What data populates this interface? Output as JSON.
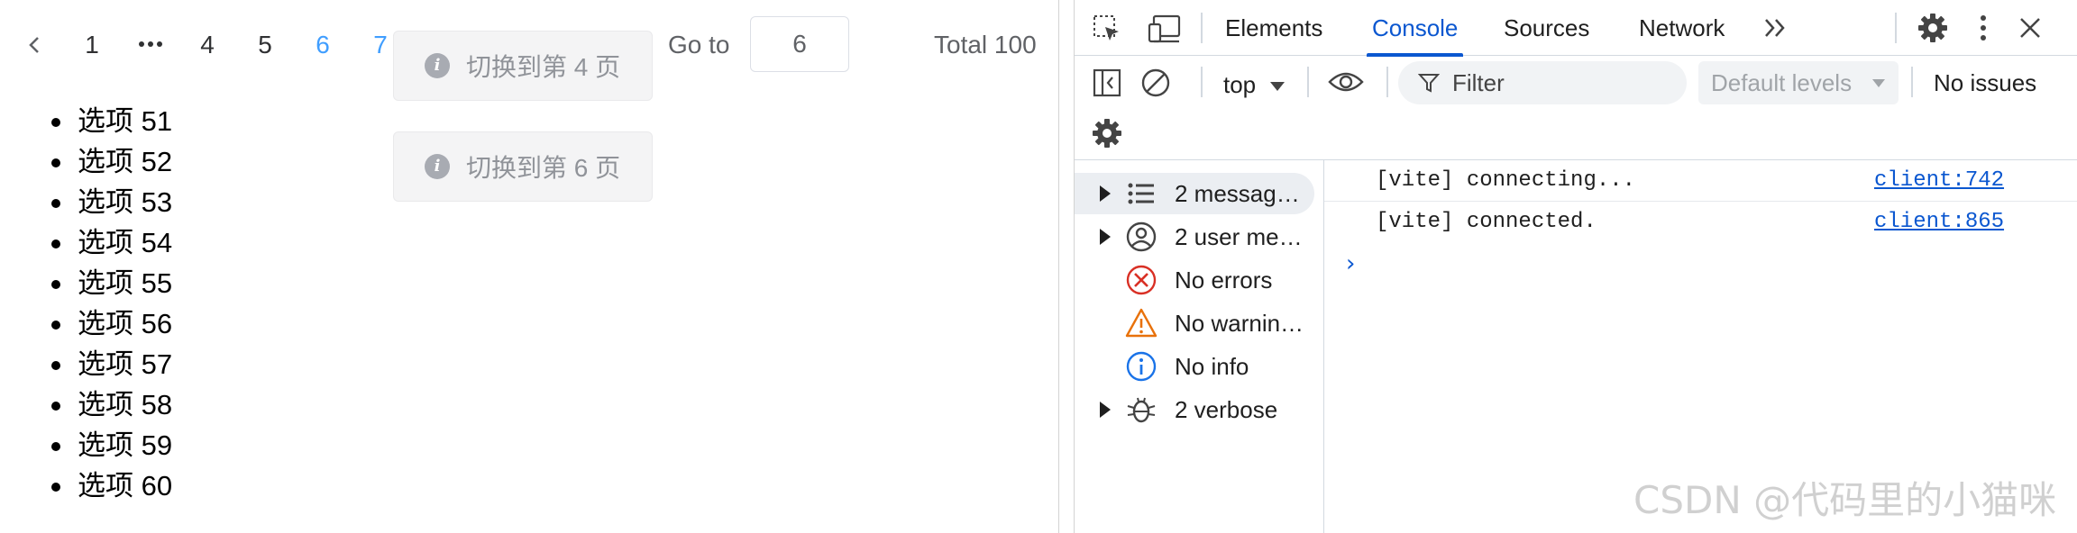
{
  "pagination": {
    "prev_icon": "chevron-left-icon",
    "pages": [
      "1",
      "4",
      "5",
      "6",
      "7"
    ],
    "active_page": "6",
    "ellipsis_icon": "more-dots-icon",
    "goto_label": "Go to",
    "goto_value": "6",
    "total_label": "Total 100"
  },
  "tooltips": [
    {
      "text": "切换到第 4 页",
      "icon": "info-icon"
    },
    {
      "text": "切换到第 6 页",
      "icon": "info-icon"
    }
  ],
  "options": [
    "选项 51",
    "选项 52",
    "选项 53",
    "选项 54",
    "选项 55",
    "选项 56",
    "选项 57",
    "选项 58",
    "选项 59",
    "选项 60"
  ],
  "devtools": {
    "tabs": [
      "Elements",
      "Console",
      "Sources",
      "Network"
    ],
    "active_tab": "Console",
    "toolbar": {
      "context": "top",
      "filter_placeholder": "Filter",
      "levels": "Default levels",
      "issues": "No issues"
    },
    "sidebar": [
      {
        "label": "2 messag…",
        "icon": "list-icon",
        "expandable": true,
        "selected": true
      },
      {
        "label": "2 user me…",
        "icon": "user-icon",
        "expandable": true,
        "selected": false
      },
      {
        "label": "No errors",
        "icon": "error-icon",
        "expandable": false,
        "selected": false
      },
      {
        "label": "No warnin…",
        "icon": "warning-icon",
        "expandable": false,
        "selected": false
      },
      {
        "label": "No info",
        "icon": "info-icon",
        "expandable": false,
        "selected": false
      },
      {
        "label": "2 verbose",
        "icon": "bug-icon",
        "expandable": true,
        "selected": false
      }
    ],
    "logs": [
      {
        "message": "[vite] connecting...",
        "source": "client:742"
      },
      {
        "message": "[vite] connected.",
        "source": "client:865"
      }
    ],
    "colors": {
      "accent": "#0b57d0",
      "error": "#d93025",
      "warning": "#e8710a",
      "info": "#1a73e8"
    }
  },
  "watermark": "CSDN @代码里的小猫咪"
}
